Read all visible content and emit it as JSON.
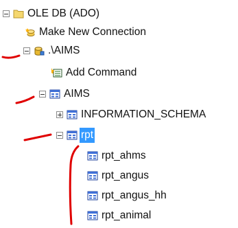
{
  "tree": {
    "root": {
      "label": "OLE DB (ADO)",
      "expanded": true
    },
    "make_new_connection": {
      "label": "Make New Connection"
    },
    "connection": {
      "label": ".\\AIMS",
      "expanded": true
    },
    "add_command": {
      "label": "Add Command"
    },
    "database": {
      "label": "AIMS",
      "expanded": true
    },
    "schema_information": {
      "label": "INFORMATION_SCHEMA",
      "expanded": false
    },
    "schema_rpt": {
      "label": "rpt",
      "expanded": true,
      "selected": true
    },
    "tables": [
      {
        "label": "rpt_ahms"
      },
      {
        "label": "rpt_angus"
      },
      {
        "label": "rpt_angus_hh"
      },
      {
        "label": "rpt_animal"
      }
    ]
  },
  "colors": {
    "selection": "#3399ff",
    "annotation": "#e00000",
    "folder": "#f5d76e"
  }
}
